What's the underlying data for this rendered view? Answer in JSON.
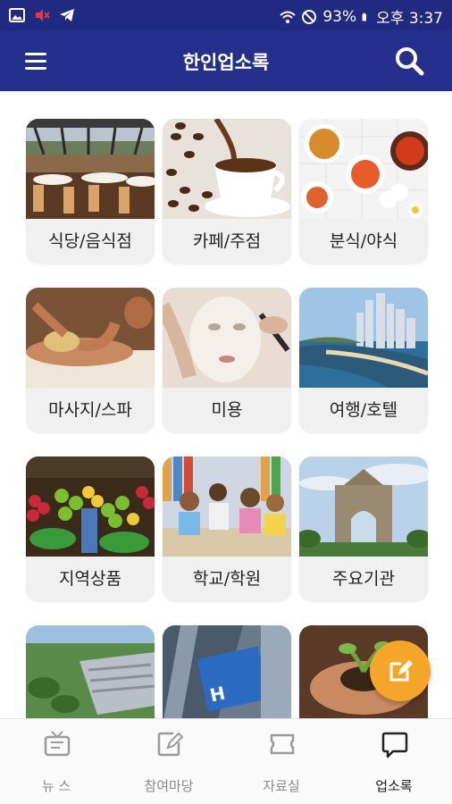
{
  "status_bar": {
    "battery": "93%",
    "time": "오후 3:37",
    "icons": [
      "image-icon",
      "mute-icon",
      "telegram-icon",
      "wifi-icon",
      "do-not-disturb-icon",
      "battery-icon"
    ]
  },
  "app_bar": {
    "title": "한인업소록",
    "menu_icon": "hamburger-menu-icon",
    "search_icon": "search-icon"
  },
  "categories": [
    {
      "label": "식당/음식점",
      "image": "restaurant-dining-room"
    },
    {
      "label": "카페/주점",
      "image": "coffee-cup-beans"
    },
    {
      "label": "분식/야식",
      "image": "korean-snack-dishes"
    },
    {
      "label": "마사지/스파",
      "image": "massage"
    },
    {
      "label": "미용",
      "image": "facial-beauty"
    },
    {
      "label": "여행/호텔",
      "image": "coastal-city-skyline"
    },
    {
      "label": "지역상품",
      "image": "fruit-market"
    },
    {
      "label": "학교/학원",
      "image": "students-library"
    },
    {
      "label": "주요기관",
      "image": "monument-arch"
    },
    {
      "label": "",
      "image": "aerial-industrial-complex"
    },
    {
      "label": "",
      "image": "hospital-building"
    },
    {
      "label": "",
      "image": "hands-holding-seedling"
    }
  ],
  "fab": {
    "icon": "edit-icon"
  },
  "bottom_nav": [
    {
      "label": "뉴 스",
      "icon": "tv-icon",
      "active": false
    },
    {
      "label": "참여마당",
      "icon": "edit-note-icon",
      "active": false
    },
    {
      "label": "자료실",
      "icon": "ticket-icon",
      "active": false
    },
    {
      "label": "업소록",
      "icon": "chat-bubble-icon",
      "active": true
    }
  ],
  "colors": {
    "primary": "#252f8c",
    "status_bar": "#202a80",
    "fab": "#f5a52a",
    "card_bg": "#f0f0f0"
  }
}
